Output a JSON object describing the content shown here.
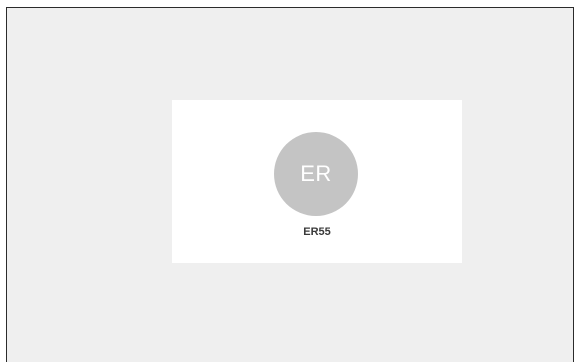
{
  "profile": {
    "avatar_initials": "ER",
    "username": "ER55"
  },
  "colors": {
    "page_background": "#efefef",
    "card_background": "#ffffff",
    "avatar_background": "#c4c4c4",
    "avatar_text": "#ffffff",
    "username_text": "#3a3a3a"
  }
}
